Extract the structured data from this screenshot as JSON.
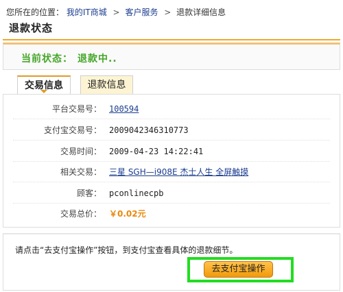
{
  "breadcrumb": {
    "prefix": "您所在的位置：",
    "items": [
      {
        "label": "我的IT商城"
      },
      {
        "label": "客户服务"
      },
      {
        "label": "退款详细信息"
      }
    ],
    "separator": ">"
  },
  "page_title": "退款状态",
  "status": {
    "label": "当前状态：",
    "value": "退款中..",
    "color": "#44a628"
  },
  "tabs": [
    {
      "label": "交易信息",
      "active": true
    },
    {
      "label": "退款信息",
      "active": false
    }
  ],
  "transaction": {
    "fields": [
      {
        "label": "平台交易号：",
        "value": "100594"
      },
      {
        "label": "支付宝交易号：",
        "value": "2009042346310773"
      },
      {
        "label": "交易时间：",
        "value": "2009-04-23 14:22:41"
      },
      {
        "label": "相关交易：",
        "value": "三星 SGH—i908E 杰士人生 全屏触摸"
      },
      {
        "label": "顾客：",
        "value": "pconlinecpb"
      },
      {
        "label": "交易总价：",
        "value": "￥0.02元"
      }
    ]
  },
  "notice": {
    "text": "请点击“去支付宝操作”按钮，到支付宝查看具体的退款细节。"
  },
  "actions": {
    "alipay_button_label": "去支付宝操作",
    "highlight_color": "#22dd22",
    "button_color": "#f5a623"
  }
}
